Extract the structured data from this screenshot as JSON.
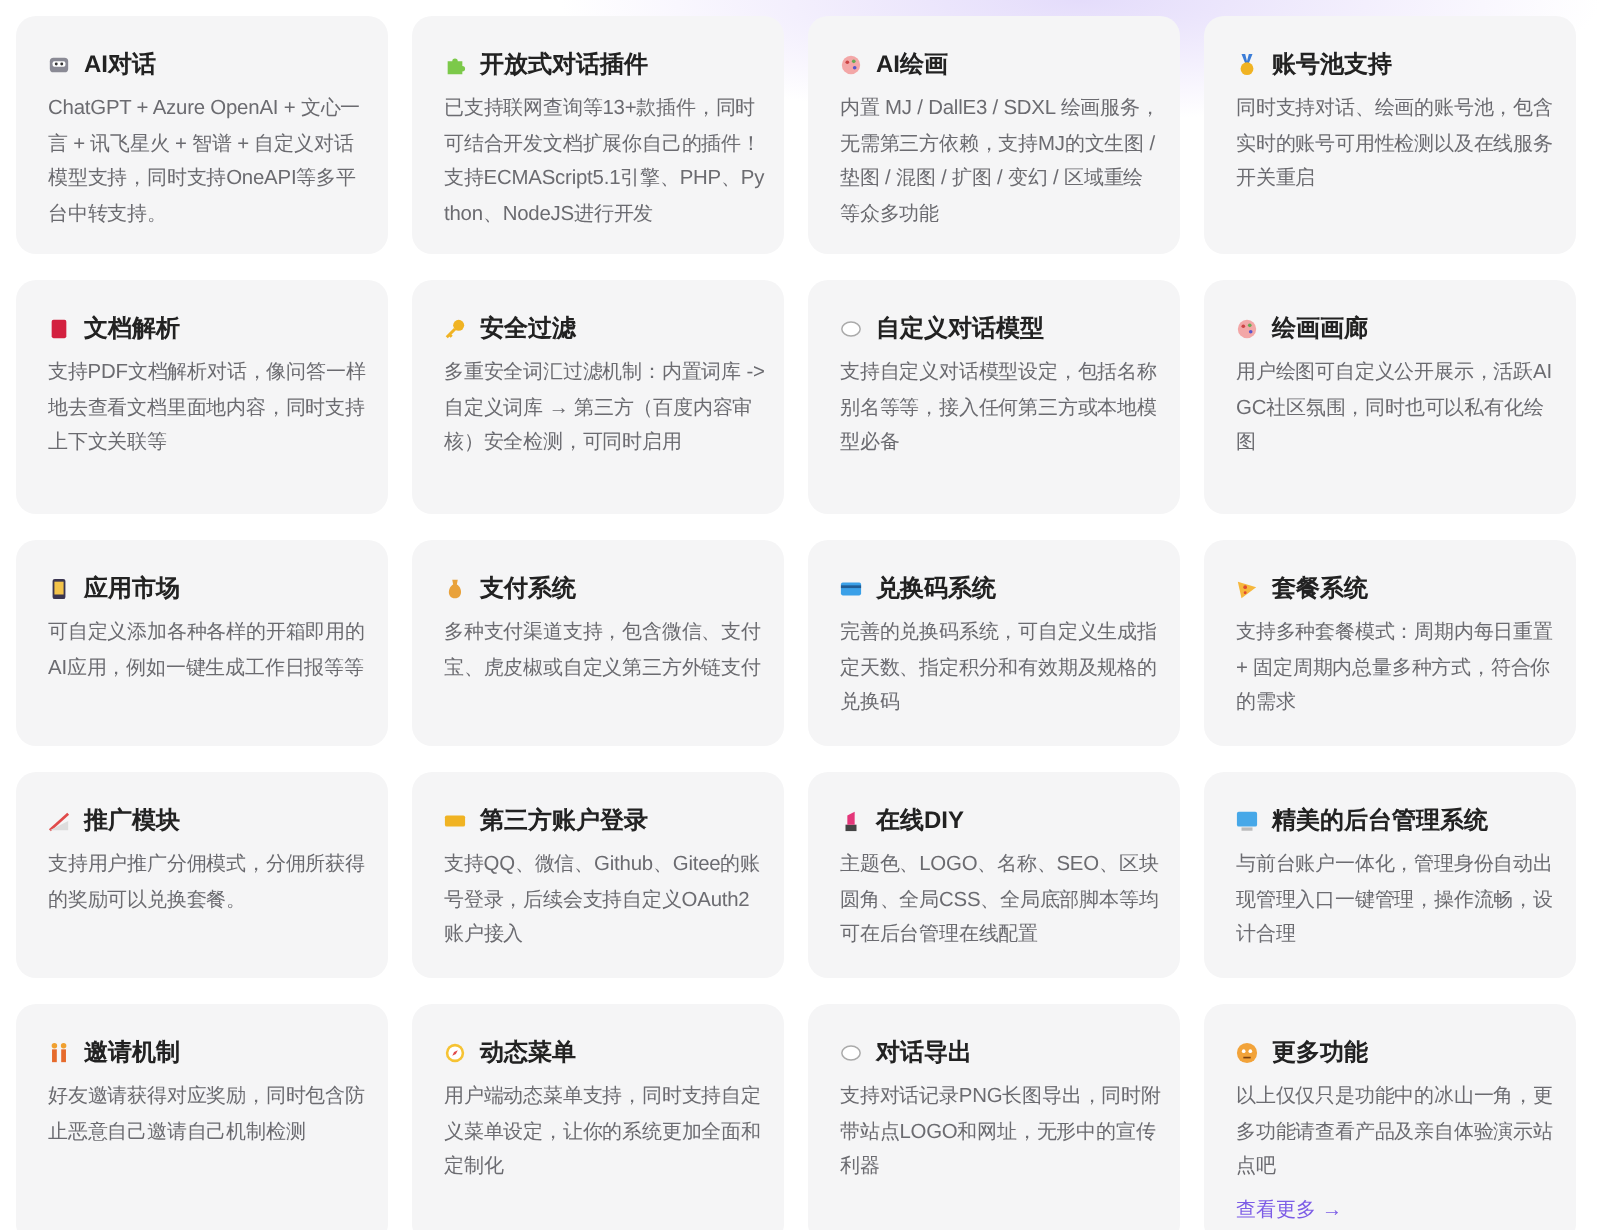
{
  "features": [
    {
      "title": "AI对话",
      "description": "ChatGPT + Azure OpenAI + 文心一言 + 讯飞星火 + 智谱 + 自定义对话模型支持，同时支持OneAPI等多平台中转支持。"
    },
    {
      "title": "开放式对话插件",
      "description": "已支持联网查询等13+款插件，同时可结合开发文档扩展你自己的插件！支持ECMAScript5.1引擎、PHP、Python、NodeJS进行开发"
    },
    {
      "title": "AI绘画",
      "description": "内置 MJ / DallE3 / SDXL 绘画服务，无需第三方依赖，支持MJ的文生图 / 垫图 / 混图 / 扩图 / 变幻 / 区域重绘等众多功能"
    },
    {
      "title": "账号池支持",
      "description": "同时支持对话、绘画的账号池，包含实时的账号可用性检测以及在线服务开关重启"
    },
    {
      "title": "文档解析",
      "description": "支持PDF文档解析对话，像问答一样地去查看文档里面地内容，同时支持上下文关联等"
    },
    {
      "title": "安全过滤",
      "description": "多重安全词汇过滤机制：内置词库 -> 自定义词库 → 第三方（百度内容审核）安全检测，可同时启用"
    },
    {
      "title": "自定义对话模型",
      "description": "支持自定义对话模型设定，包括名称别名等等，接入任何第三方或本地模型必备"
    },
    {
      "title": "绘画画廊",
      "description": "用户绘图可自定义公开展示，活跃AIGC社区氛围，同时也可以私有化绘图"
    },
    {
      "title": "应用市场",
      "description": "可自定义添加各种各样的开箱即用的AI应用，例如一键生成工作日报等等"
    },
    {
      "title": "支付系统",
      "description": "多种支付渠道支持，包含微信、支付宝、虎皮椒或自定义第三方外链支付"
    },
    {
      "title": "兑换码系统",
      "description": "完善的兑换码系统，可自定义生成指定天数、指定积分和有效期及规格的兑换码"
    },
    {
      "title": "套餐系统",
      "description": "支持多种套餐模式：周期内每日重置 + 固定周期内总量多种方式，符合你的需求"
    },
    {
      "title": "推广模块",
      "description": "支持用户推广分佣模式，分佣所获得的奖励可以兑换套餐。"
    },
    {
      "title": "第三方账户登录",
      "description": "支持QQ、微信、Github、Gitee的账号登录，后续会支持自定义OAuth2账户接入"
    },
    {
      "title": "在线DIY",
      "description": "主题色、LOGO、名称、SEO、区块圆角、全局CSS、全局底部脚本等均可在后台管理在线配置"
    },
    {
      "title": "精美的后台管理系统",
      "description": "与前台账户一体化，管理身份自动出现管理入口一键管理，操作流畅，设计合理"
    },
    {
      "title": "邀请机制",
      "description": "好友邀请获得对应奖励，同时包含防止恶意自己邀请自己机制检测"
    },
    {
      "title": "动态菜单",
      "description": "用户端动态菜单支持，同时支持自定义菜单设定，让你的系统更加全面和定制化"
    },
    {
      "title": "对话导出",
      "description": "支持对话记录PNG长图导出，同时附带站点LOGO和网址，无形中的宣传利器"
    },
    {
      "title": "更多功能",
      "description": "以上仅仅只是功能中的冰山一角，更多功能请查看产品及亲自体验演示站点吧",
      "link": "查看更多 →"
    }
  ]
}
